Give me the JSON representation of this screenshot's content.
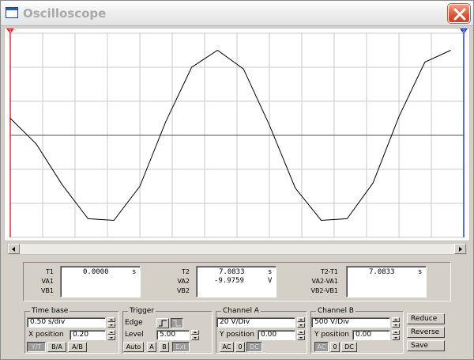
{
  "window": {
    "title": "Oscilloscope"
  },
  "colors": {
    "trace": "#000000",
    "grid": "#c8c8c8",
    "cursor1": "#e03030",
    "cursor2": "#2a3cc8",
    "screen_bg": "#ffffff"
  },
  "chart_data": {
    "type": "line",
    "title": "",
    "grid": true,
    "divisions": {
      "x": 14,
      "y": 6
    },
    "time_per_div_s": 0.5,
    "x_range_s": [
      0,
      7
    ],
    "series": [
      {
        "x": [
          0,
          0.4,
          0.8,
          1.2,
          1.6,
          2.0,
          2.4,
          2.8,
          3.2,
          3.6,
          4.0,
          4.4,
          4.8,
          5.2,
          5.6,
          6.0,
          6.4,
          6.8
        ],
        "y": [
          0.5,
          -0.25,
          -1.45,
          -2.45,
          -2.5,
          -1.5,
          0.4,
          2.0,
          2.5,
          1.95,
          0.3,
          -1.55,
          -2.5,
          -2.45,
          -1.4,
          0.55,
          2.15,
          2.5
        ]
      }
    ],
    "cursors": [
      {
        "label": "1",
        "x": 0
      },
      {
        "label": "2",
        "x": 14
      }
    ]
  },
  "readout": {
    "t1": {
      "label": "T1",
      "value": "0.0000",
      "unit": "s"
    },
    "va1": {
      "label": "VA1",
      "value": ""
    },
    "vb1": {
      "label": "VB1",
      "value": ""
    },
    "t2": {
      "label": "T2",
      "value": "7.0833",
      "unit": "s"
    },
    "va2": {
      "label": "VA2",
      "value": "-9.9759",
      "unit": "V"
    },
    "vb2": {
      "label": "VB2",
      "value": ""
    },
    "dt": {
      "label": "T2-T1",
      "value": "7.0833",
      "unit": "s"
    },
    "dva": {
      "label": "VA2-VA1",
      "value": ""
    },
    "dvb": {
      "label": "VB2-VB1",
      "value": ""
    }
  },
  "timebase": {
    "title": "Time base",
    "scale": "0.50 s/div",
    "xpos_label": "X position",
    "xpos": "0.20",
    "buttons": [
      "Y/T",
      "B/A",
      "A/B"
    ]
  },
  "trigger": {
    "title": "Trigger",
    "edge_label": "Edge",
    "level_label": "Level",
    "level": "5.00",
    "buttons": [
      "Auto",
      "A",
      "B",
      "Ext"
    ]
  },
  "channel_a": {
    "title": "Channel A",
    "scale": "20 V/Div",
    "ypos_label": "Y position",
    "ypos": "0.00",
    "buttons": [
      "AC",
      "0",
      "DC"
    ]
  },
  "channel_b": {
    "title": "Channel B",
    "scale": "500 V/Div",
    "ypos_label": "Y position",
    "ypos": "0.00",
    "buttons": [
      "AC",
      "0",
      "DC"
    ]
  },
  "side_buttons": {
    "reduce": "Reduce",
    "reverse": "Reverse",
    "save": "Save"
  }
}
